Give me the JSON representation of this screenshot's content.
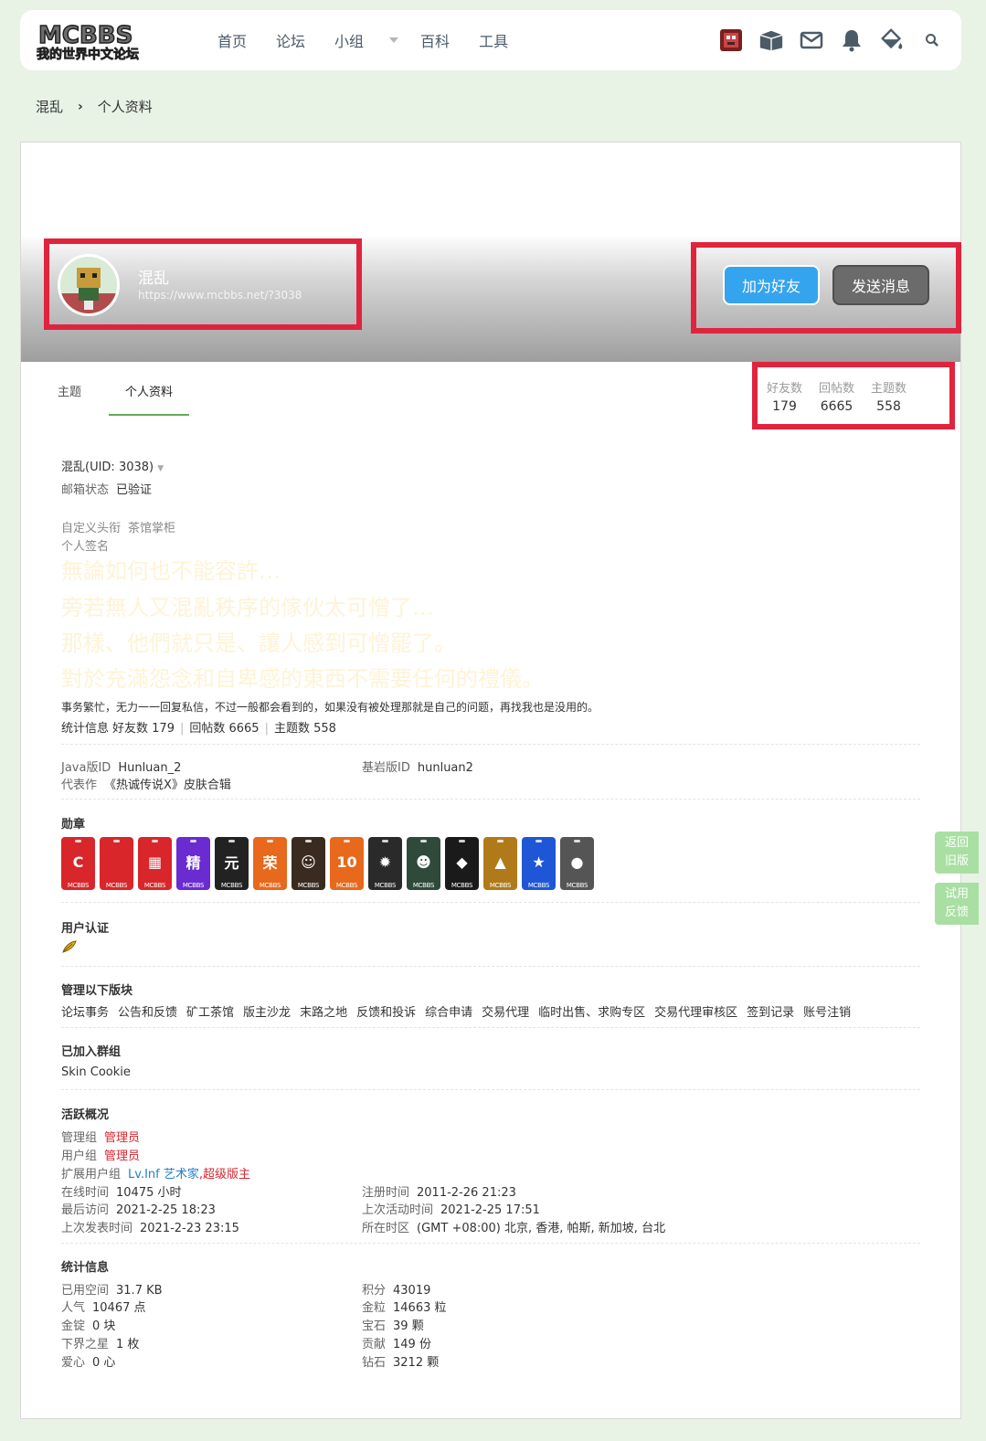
{
  "nav": {
    "logo_text": "MCBBS 我的世界中文论坛",
    "items": [
      "首页",
      "论坛",
      "小组",
      "百科",
      "工具"
    ]
  },
  "tools": [
    "avatar-icon",
    "box-icon",
    "mail-icon",
    "bell-icon",
    "paint-bucket-icon",
    "search-icon"
  ],
  "breadcrumb": {
    "home": "混乱",
    "current": "个人资料"
  },
  "profile": {
    "name": "混乱",
    "url": "https://www.mcbbs.net/?3038",
    "add_friend": "加为好友",
    "send_message": "发送消息"
  },
  "tabs": [
    "主题",
    "个人资料"
  ],
  "stats": [
    {
      "label": "好友数",
      "value": "179"
    },
    {
      "label": "回帖数",
      "value": "6665"
    },
    {
      "label": "主题数",
      "value": "558"
    }
  ],
  "info": {
    "uid": "混乱(UID: 3038)",
    "email_k": "邮箱状态",
    "email_v": "已验证",
    "title_k": "自定义头衔",
    "title_v": "茶馆掌柜",
    "sig_k": "个人签名",
    "sig_lines": [
      "無論如何也不能容許…",
      "旁若無人又混亂秩序的傢伙太可憎了…",
      "那樣、他們就只是、讓人感到可憎罷了。",
      "對於充滿怨念和自卑感的東西不需要任何的禮儀。"
    ],
    "note": "事务繁忙，无力一一回复私信，不过一般都会看到的，如果没有被处理那就是自己的问题，再找我也是没用的。",
    "statline_k": "统计信息",
    "statline": [
      "好友数 179",
      "回帖数 6665",
      "主题数 558"
    ],
    "java_k": "Java版ID",
    "java_v": "Hunluan_2",
    "bedrock_k": "基岩版ID",
    "bedrock_v": "hunluan2",
    "works_k": "代表作",
    "works_v": "《热诚传说X》皮肤合辑"
  },
  "medals": {
    "title": "勋章",
    "brand": "MCBBS",
    "items": [
      {
        "glyph": "C",
        "color": "#d8262a"
      },
      {
        "glyph": "",
        "color": "#d8262a"
      },
      {
        "glyph": "▦",
        "color": "#d8262a"
      },
      {
        "glyph": "精",
        "color": "#6a2bd0"
      },
      {
        "glyph": "元",
        "color": "#222222"
      },
      {
        "glyph": "荣",
        "color": "#e8681c"
      },
      {
        "glyph": "☺",
        "color": "#3a2b20"
      },
      {
        "glyph": "10",
        "color": "#e8681c"
      },
      {
        "glyph": "✹",
        "color": "#2a2a2a"
      },
      {
        "glyph": "☻",
        "color": "#2f4a3a"
      },
      {
        "glyph": "◆",
        "color": "#1a1a1a"
      },
      {
        "glyph": "▲",
        "color": "#b07a1a"
      },
      {
        "glyph": "★",
        "color": "#1f56d6"
      },
      {
        "glyph": "●",
        "color": "#555555"
      }
    ]
  },
  "verify": {
    "title": "用户认证",
    "icon": "feather-icon"
  },
  "manage": {
    "title": "管理以下版块",
    "items": [
      "论坛事务",
      "公告和反馈",
      "矿工茶馆",
      "版主沙龙",
      "末路之地",
      "反馈和投诉",
      "综合申请",
      "交易代理",
      "临时出售、求购专区",
      "交易代理审核区",
      "签到记录",
      "账号注销"
    ]
  },
  "groups": {
    "title": "已加入群组",
    "items": [
      "Skin Cookie"
    ]
  },
  "activity": {
    "title": "活跃概况",
    "admin_k": "管理组",
    "admin_v": "管理员",
    "user_k": "用户组",
    "user_v": "管理员",
    "ext_k": "扩展用户组",
    "ext_v1": "Lv.Inf 艺术家",
    "ext_v2": ",超级版主",
    "online_k": "在线时间",
    "online_v": "10475 小时",
    "reg_k": "注册时间",
    "reg_v": "2011-2-26 21:23",
    "last_visit_k": "最后访问",
    "last_visit_v": "2021-2-25 18:23",
    "last_active_k": "上次活动时间",
    "last_active_v": "2021-2-25 17:51",
    "last_post_k": "上次发表时间",
    "last_post_v": "2021-2-23 23:15",
    "tz_k": "所在时区",
    "tz_v": "(GMT +08:00) 北京, 香港, 帕斯, 新加坡, 台北"
  },
  "statistics": {
    "title": "统计信息",
    "left": [
      {
        "k": "已用空间",
        "v": "31.7 KB"
      },
      {
        "k": "人气",
        "v": "10467 点"
      },
      {
        "k": "金锭",
        "v": "0 块"
      },
      {
        "k": "下界之星",
        "v": "1 枚"
      },
      {
        "k": "爱心",
        "v": "0 心"
      }
    ],
    "right": [
      {
        "k": "积分",
        "v": "43019"
      },
      {
        "k": "金粒",
        "v": "14663 粒"
      },
      {
        "k": "宝石",
        "v": "39 颗"
      },
      {
        "k": "贡献",
        "v": "149 份"
      },
      {
        "k": "钻石",
        "v": "3212 颗"
      }
    ]
  },
  "side": {
    "back": "返回旧版",
    "feedback": "试用反馈"
  }
}
